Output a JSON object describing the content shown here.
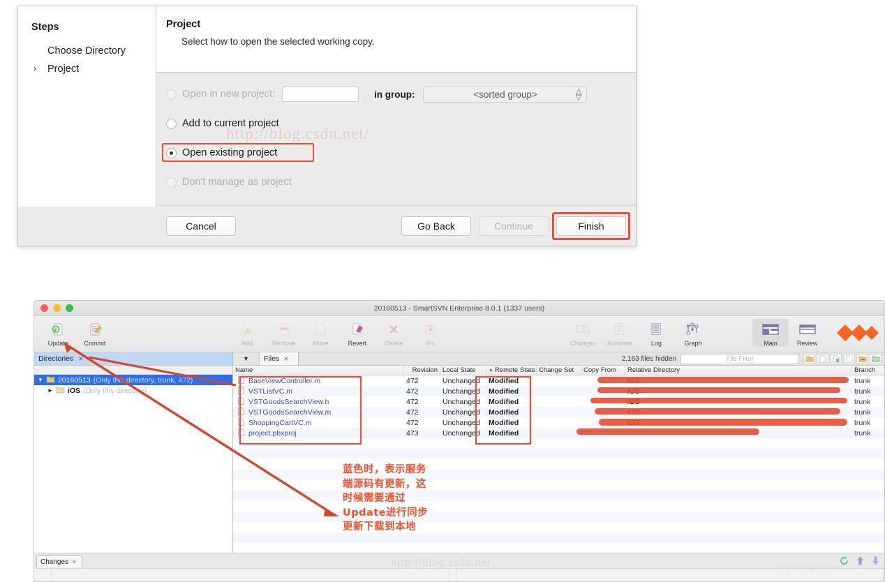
{
  "wizard": {
    "steps_title": "Steps",
    "steps": [
      {
        "label": "Choose Directory",
        "chevron": ""
      },
      {
        "label": "Project",
        "chevron": "›"
      }
    ],
    "header_title": "Project",
    "header_subtitle": "Select how to open the selected working copy.",
    "options": [
      {
        "label": "Open in new project:",
        "selected": false,
        "disabled": true
      },
      {
        "label": "Add to current project",
        "selected": false,
        "disabled": false
      },
      {
        "label": "Open existing project",
        "selected": true,
        "disabled": false
      },
      {
        "label": "Don't manage as project",
        "selected": false,
        "disabled": true
      }
    ],
    "name_input_value": "",
    "name_input_placeholder": "",
    "in_group_label": "in group:",
    "group_combo_value": "<sorted group>",
    "buttons": {
      "cancel": "Cancel",
      "go_back": "Go Back",
      "continue": "Continue",
      "finish": "Finish"
    },
    "watermark": "http://blog.csdn.net/",
    "highlight_color": "#e8503a"
  },
  "svn": {
    "window_title": "20160513 - SmartSVN Enterprise 8.0.1 (1337 users)",
    "toolbar_left": [
      {
        "label": "Update",
        "icon": "update-icon",
        "enabled": true
      },
      {
        "label": "Commit",
        "icon": "commit-icon",
        "enabled": true
      }
    ],
    "toolbar_mid": [
      {
        "label": "Add",
        "icon": "add-icon",
        "enabled": false
      },
      {
        "label": "Remove",
        "icon": "remove-icon",
        "enabled": false
      },
      {
        "label": "Move",
        "icon": "move-icon",
        "enabled": false
      },
      {
        "label": "Revert",
        "icon": "revert-icon",
        "enabled": true
      },
      {
        "label": "Delete",
        "icon": "delete-icon",
        "enabled": false
      },
      {
        "label": "Fix",
        "icon": "fix-icon",
        "enabled": false
      }
    ],
    "toolbar_right": [
      {
        "label": "Changes",
        "icon": "changes-icon",
        "enabled": false
      },
      {
        "label": "Annotate",
        "icon": "annotate-icon",
        "enabled": false
      },
      {
        "label": "Log",
        "icon": "log-icon",
        "enabled": true
      },
      {
        "label": "Graph",
        "icon": "graph-icon",
        "enabled": true
      }
    ],
    "view_buttons": [
      {
        "label": "Main",
        "icon": "main-layout-icon",
        "selected": true
      },
      {
        "label": "Review",
        "icon": "review-layout-icon",
        "selected": false
      }
    ],
    "tabs": {
      "directories": "Directories",
      "files": "Files"
    },
    "files_hidden": "2,163 files hidden",
    "filter_placeholder": "File Filter",
    "mini_icon_names": [
      "open-folder-icon",
      "new-file-icon",
      "file-properties-icon",
      "blank-file-icon",
      "export-folder-icon",
      "import-folder-icon"
    ],
    "tree": [
      {
        "label": "20160513",
        "detail": "(Only this directory, trunk, 472)",
        "selected": true,
        "depth": 0
      },
      {
        "label": "iOS",
        "detail": "(Only this directory)",
        "selected": false,
        "depth": 1
      }
    ],
    "file_columns": [
      "Name",
      "Revision",
      "Local State",
      "Remote State",
      "Change Set",
      "Copy From",
      "Relative Directory",
      "Branch"
    ],
    "files": [
      {
        "name": "BaseViewController.m",
        "revision": "472",
        "local_state": "Unchanged",
        "remote_state": "Modified",
        "change_set": "",
        "copy_from": "",
        "relative_directory": "iOS",
        "branch": "trunk"
      },
      {
        "name": "VSTListVC.m",
        "revision": "472",
        "local_state": "Unchanged",
        "remote_state": "Modified",
        "change_set": "",
        "copy_from": "",
        "relative_directory": "iOS",
        "branch": "trunk"
      },
      {
        "name": "VSTGoodsSearchView.h",
        "revision": "472",
        "local_state": "Unchanged",
        "remote_state": "Modified",
        "change_set": "",
        "copy_from": "",
        "relative_directory": "iOS",
        "branch": "trunk"
      },
      {
        "name": "VSTGoodsSearchView.m",
        "revision": "472",
        "local_state": "Unchanged",
        "remote_state": "Modified",
        "change_set": "",
        "copy_from": "",
        "relative_directory": "iOS",
        "branch": "trunk"
      },
      {
        "name": "ShoppingCartVC.m",
        "revision": "472",
        "local_state": "Unchanged",
        "remote_state": "Modified",
        "change_set": "",
        "copy_from": "",
        "relative_directory": "iOS",
        "branch": "trunk"
      },
      {
        "name": "project.pbxproj",
        "revision": "473",
        "local_state": "Unchanged",
        "remote_state": "Modified",
        "change_set": "",
        "copy_from": "",
        "relative_directory": "",
        "branch": "trunk"
      }
    ],
    "bottom_tab": "Changes",
    "bottom_icon_names": [
      "refresh-icon",
      "previous-change-icon",
      "next-change-icon"
    ],
    "watermark": "http://blog.csdn.net"
  },
  "annotation": {
    "note_text": "蓝色时，表示服务端源码有更新，这时候需要通过Update进行同步更新下载到本地",
    "marker_color": "#e8472a",
    "note_color": "#f2512c"
  }
}
